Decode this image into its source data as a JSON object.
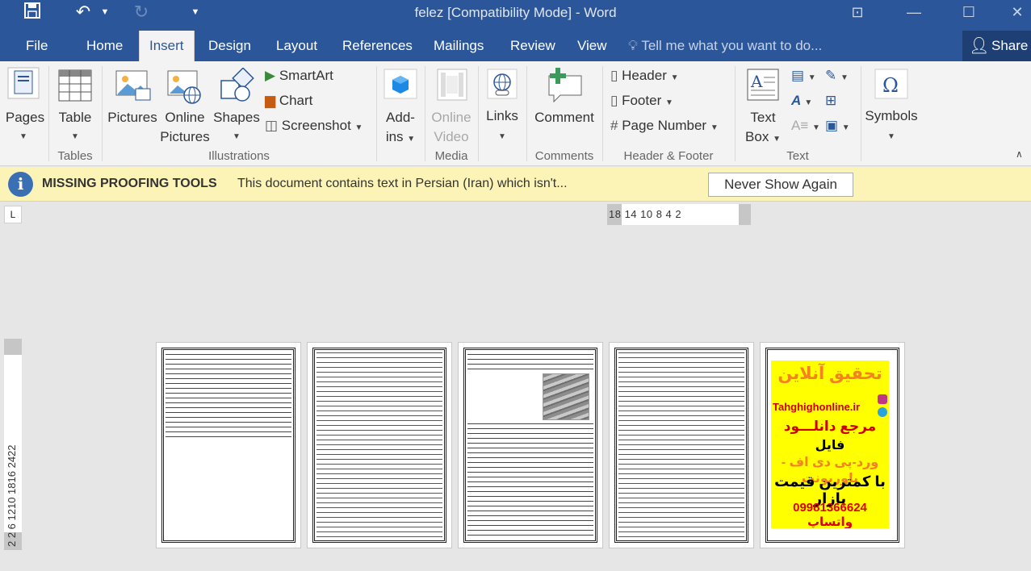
{
  "window": {
    "title": "felez [Compatibility Mode] - Word"
  },
  "tabs": [
    "File",
    "Home",
    "Insert",
    "Design",
    "Layout",
    "References",
    "Mailings",
    "Review",
    "View"
  ],
  "active_tab": "Insert",
  "tell_me": "Tell me what you want to do...",
  "share": "Share",
  "ribbon": {
    "pages": "Pages",
    "table": "Table",
    "pictures": "Pictures",
    "online_pictures_1": "Online",
    "online_pictures_2": "Pictures",
    "shapes": "Shapes",
    "smartart": "SmartArt",
    "chart": "Chart",
    "screenshot": "Screenshot",
    "addins_1": "Add-",
    "addins_2": "ins",
    "online_video_1": "Online",
    "online_video_2": "Video",
    "links": "Links",
    "comment": "Comment",
    "header": "Header",
    "footer": "Footer",
    "page_number": "Page Number",
    "text_box_1": "Text",
    "text_box_2": "Box",
    "symbols": "Symbols",
    "groups": {
      "tables": "Tables",
      "illustrations": "Illustrations",
      "media": "Media",
      "comments": "Comments",
      "header_footer": "Header & Footer",
      "text": "Text"
    }
  },
  "infobar": {
    "title": "MISSING PROOFING TOOLS",
    "message": "This document contains text in Persian (Iran) which isn't...",
    "button": "Never Show Again"
  },
  "horizontal_ruler": "18    14    10 8    4  2",
  "vertical_ruler": "2  2  6  1210  1816  2422",
  "ad": {
    "line1": "تحقیق آنلاین",
    "site": "Tahghighonline.ir",
    "line2": "مرجع دانلـــود",
    "line3": "فایل",
    "line4": "ورد-پی دی اف - پاورپونت",
    "line5": "با کمترین قیمت بازار",
    "phone": "09981366624 واتساپ"
  },
  "colors": {
    "titlebar": "#2b579a",
    "ribbon": "#f3f3f3",
    "infobar": "#fcf4b6",
    "ad_bg": "#ffff00",
    "ad_orange": "#f58220",
    "ad_red": "#cc0000"
  }
}
